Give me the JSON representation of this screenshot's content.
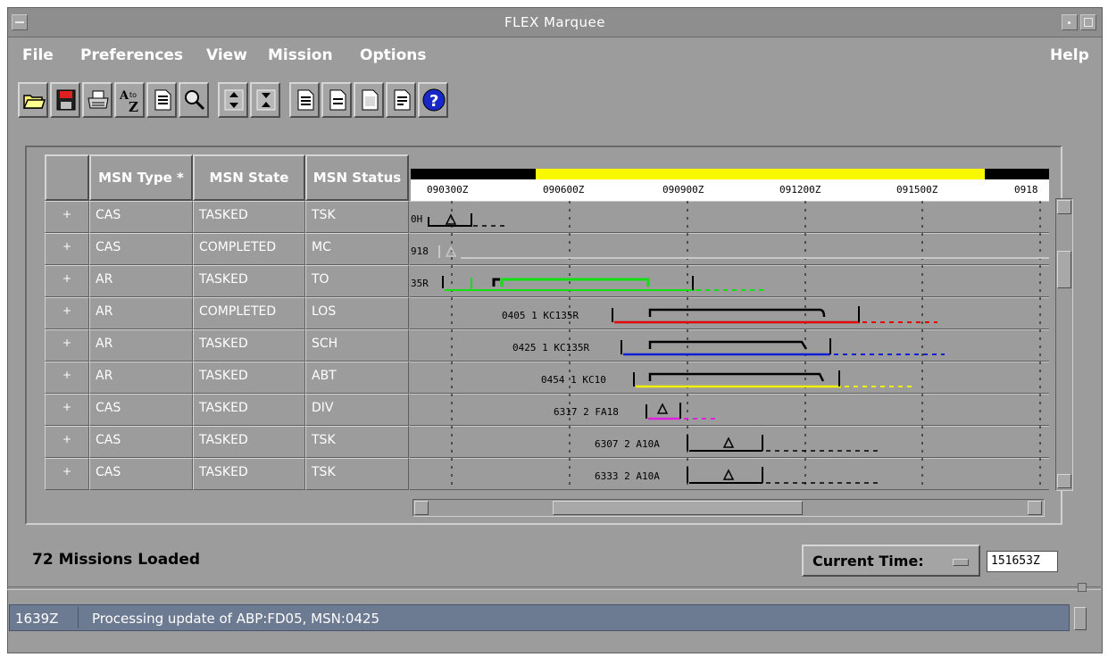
{
  "window": {
    "title": "FLEX Marquee"
  },
  "menu": {
    "file": "File",
    "preferences": "Preferences",
    "view": "View",
    "mission": "Mission",
    "options": "Options",
    "help": "Help"
  },
  "toolbar": {
    "icons": [
      "open-folder-icon",
      "save-icon",
      "print-icon",
      "sort-az-icon",
      "document-icon",
      "search-icon",
      "expand-up-icon",
      "expand-down-icon",
      "report-1-icon",
      "report-2-icon",
      "report-3-icon",
      "report-4-icon",
      "help-icon"
    ],
    "sort_label_top": "A",
    "sort_label_to": "to",
    "sort_label_bottom": "Z",
    "help_glyph": "?"
  },
  "grid": {
    "columns": [
      "MSN Type *",
      "MSN State",
      "MSN Status"
    ],
    "time_labels": [
      "090300Z",
      "090600Z",
      "090900Z",
      "091200Z",
      "091500Z",
      "0918"
    ],
    "rows": [
      {
        "plus": "+",
        "type": "CAS",
        "state": "TASKED",
        "status": "TSK",
        "label": "0H"
      },
      {
        "plus": "+",
        "type": "CAS",
        "state": "COMPLETED",
        "status": "MC",
        "label": "918"
      },
      {
        "plus": "+",
        "type": "AR",
        "state": "TASKED",
        "status": "TO",
        "label": "35R"
      },
      {
        "plus": "+",
        "type": "AR",
        "state": "COMPLETED",
        "status": "LOS",
        "label": "0405 1 KC135R"
      },
      {
        "plus": "+",
        "type": "AR",
        "state": "TASKED",
        "status": "SCH",
        "label": "0425 1 KC135R"
      },
      {
        "plus": "+",
        "type": "AR",
        "state": "TASKED",
        "status": "ABT",
        "label": "0454 1 KC10"
      },
      {
        "plus": "+",
        "type": "CAS",
        "state": "TASKED",
        "status": "DIV",
        "label": "6317 2 FA18"
      },
      {
        "plus": "+",
        "type": "CAS",
        "state": "TASKED",
        "status": "TSK",
        "label": "6307 2 A10A"
      },
      {
        "plus": "+",
        "type": "CAS",
        "state": "TASKED",
        "status": "TSK",
        "label": "6333 2 A10A"
      }
    ],
    "colors": {
      "red": "#e00000",
      "blue": "#1020d0",
      "yellow": "#f0f000",
      "green": "#10e010",
      "magenta": "#e020e0"
    }
  },
  "footer": {
    "missions_loaded": "72 Missions Loaded",
    "current_time_label": "Current Time:",
    "current_time_value": "151653Z"
  },
  "status": {
    "time": "1639Z",
    "message": "Processing update of ABP:FD05, MSN:0425"
  }
}
